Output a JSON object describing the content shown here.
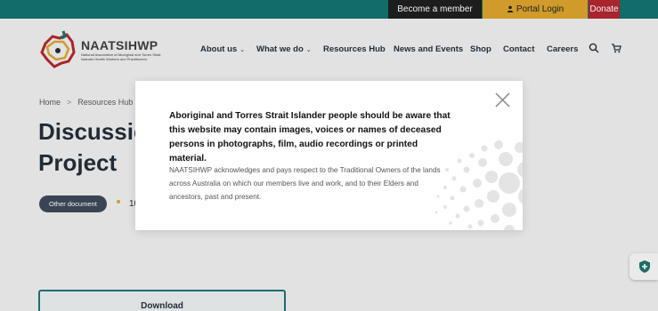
{
  "topbar": {
    "member_label": "Become a member",
    "portal_label": "Portal Login",
    "donate_label": "Donate"
  },
  "logo": {
    "title": "NAATSIHWP",
    "subtitle": "National Association of Aboriginal and Torres Strait Islander Health Workers and Practitioners"
  },
  "nav": {
    "items": [
      {
        "label": "About us",
        "has_dropdown": true
      },
      {
        "label": "What we do",
        "has_dropdown": true
      },
      {
        "label": "Resources Hub",
        "has_dropdown": false
      },
      {
        "label": "News and Events",
        "has_dropdown": false
      },
      {
        "label": "Shop",
        "has_dropdown": false
      },
      {
        "label": "Contact",
        "has_dropdown": false
      },
      {
        "label": "Careers",
        "has_dropdown": false
      }
    ],
    "chevron": "⌄"
  },
  "breadcrumb": {
    "home": "Home",
    "sep": ">",
    "resources": "Resources Hub"
  },
  "page": {
    "title_line1": "Discussio",
    "title_line2": "Project",
    "badge": "Other document",
    "date_partial": "10",
    "download_label": "Download"
  },
  "modal": {
    "heading": "Aboriginal and Torres Strait Islander people should be aware that this website may contain images, voices or names of deceased persons in photographs, film, audio recordings or printed material.",
    "body": "NAATSIHWP acknowledges and pays respect to the Traditional Owners of the lands across Australia on which our members live and work, and to their Elders and ancestors, past and present."
  },
  "icons": {
    "search": "search-icon",
    "cart": "cart-icon",
    "user": "user-icon",
    "close": "close-icon",
    "shield": "shield-icon"
  },
  "colors": {
    "topbar": "#0f6f6a",
    "member_btn": "#1b1b1b",
    "portal_btn": "#d9a12a",
    "donate_btn": "#b0232c",
    "badge": "#3a4656",
    "download_border": "#1d6e79"
  }
}
